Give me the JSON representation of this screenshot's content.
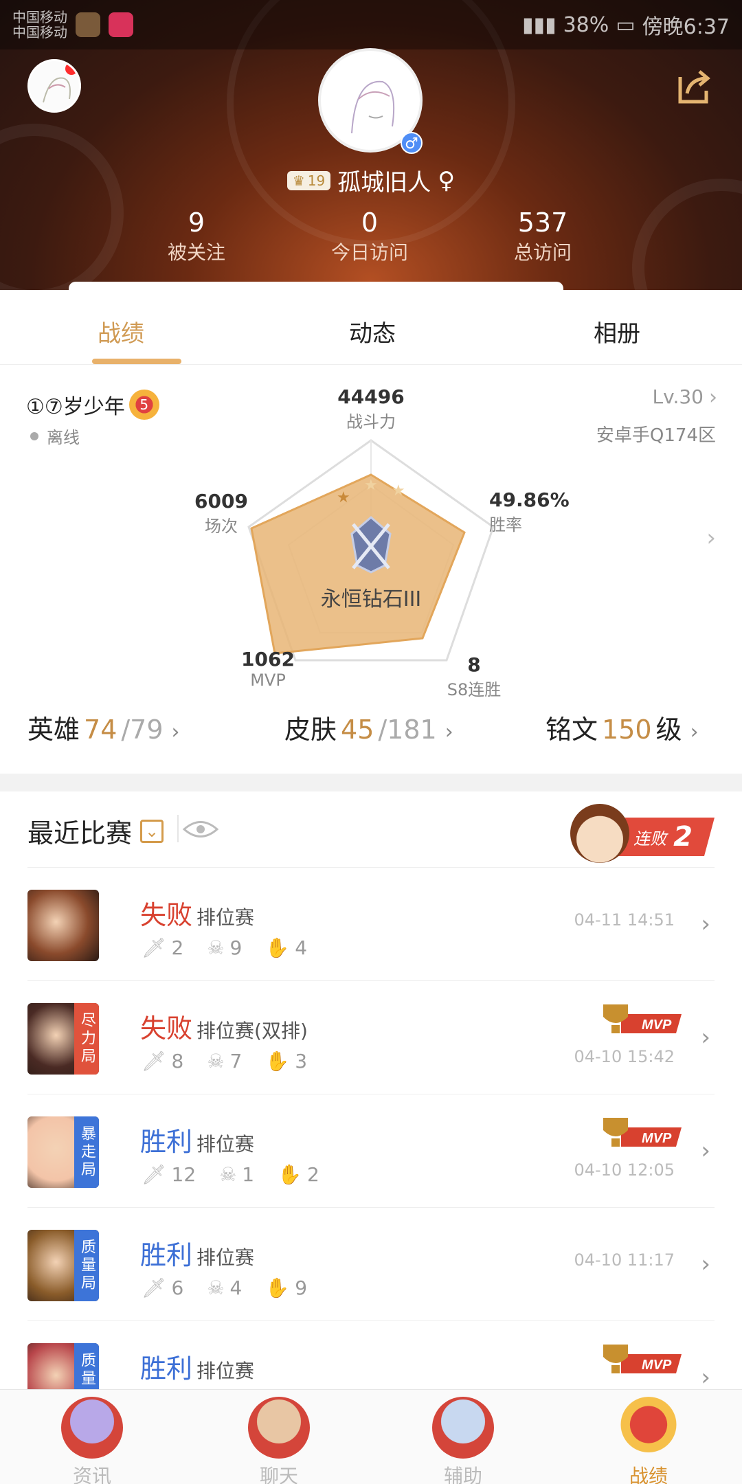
{
  "status_bar": {
    "carrier_line1": "中国移动",
    "carrier_line2": "中国移动",
    "battery": "38%",
    "time": "傍晚6:37"
  },
  "header": {
    "nickname": "孤城旧人",
    "gender_symbol": "♀",
    "gender_badge": "♂",
    "vip_level": "19",
    "stats": [
      {
        "num": "9",
        "label": "被关注"
      },
      {
        "num": "0",
        "label": "今日访问"
      },
      {
        "num": "537",
        "label": "总访问"
      }
    ]
  },
  "tabs": [
    "战绩",
    "动态",
    "相册"
  ],
  "profile": {
    "name": "①⑦岁少年",
    "rank_badge": "5",
    "status": "离线",
    "level": "Lv.30",
    "server": "安卓手Q174区",
    "rank_name": "永恒钻石III",
    "radar": {
      "power": {
        "value": "44496",
        "label": "战斗力"
      },
      "win_rate": {
        "value": "49.86%",
        "label": "胜率"
      },
      "streak": {
        "value": "8",
        "label": "S8连胜"
      },
      "mvp": {
        "value": "1062",
        "label": "MVP"
      },
      "games": {
        "value": "6009",
        "label": "场次"
      }
    },
    "counts": {
      "heroes": {
        "label": "英雄",
        "have": "74",
        "total": "/79"
      },
      "skins": {
        "label": "皮肤",
        "have": "45",
        "total": "/181"
      },
      "inscription": {
        "label": "铭文",
        "value": "150",
        "unit": "级"
      }
    }
  },
  "recent": {
    "title": "最近比赛",
    "streak_label": "连败",
    "streak_count": "2",
    "matches": [
      {
        "result": "失败",
        "type": "lose",
        "mode": "排位赛",
        "kills": "2",
        "deaths": "9",
        "assists": "4",
        "time": "04-11 14:51",
        "tag": "",
        "mvp": false,
        "color": "#8a4a2c"
      },
      {
        "result": "失败",
        "type": "lose",
        "mode": "排位赛(双排)",
        "kills": "8",
        "deaths": "7",
        "assists": "3",
        "time": "04-10 15:42",
        "tag": "尽力局",
        "tag_color": "#e0523c",
        "mvp": true,
        "color": "#4a2a24"
      },
      {
        "result": "胜利",
        "type": "win",
        "mode": "排位赛",
        "kills": "12",
        "deaths": "1",
        "assists": "2",
        "time": "04-10 12:05",
        "tag": "暴走局",
        "tag_color": "#3d74d8",
        "mvp": true,
        "color": "#f3c4a8"
      },
      {
        "result": "胜利",
        "type": "win",
        "mode": "排位赛",
        "kills": "6",
        "deaths": "4",
        "assists": "9",
        "time": "04-10 11:17",
        "tag": "质量局",
        "tag_color": "#3d74d8",
        "mvp": false,
        "color": "#8a5c2a"
      },
      {
        "result": "胜利",
        "type": "win",
        "mode": "排位赛",
        "kills": "",
        "deaths": "",
        "assists": "",
        "time": "",
        "tag": "质量局",
        "tag_color": "#3d74d8",
        "mvp": true,
        "color": "#b8454a"
      }
    ],
    "mvp_text": "MVP"
  },
  "bottom_nav": [
    {
      "label": "资讯",
      "active": false
    },
    {
      "label": "聊天",
      "active": false
    },
    {
      "label": "辅助",
      "active": false
    },
    {
      "label": "战绩",
      "active": true
    }
  ],
  "colors": {
    "accent": "#d09a53",
    "lose": "#d8412f",
    "win": "#3c6fd6"
  }
}
